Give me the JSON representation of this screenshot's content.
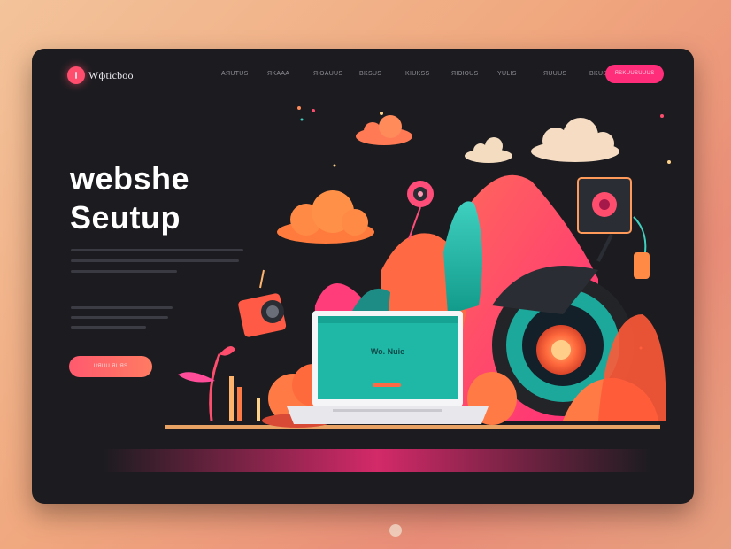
{
  "brand": {
    "name": "Wфticboo"
  },
  "nav": {
    "items": [
      "AЯUTUS",
      "ЯKAAA",
      "ЯЮAUUS",
      "BKSUS",
      "KIUKSS",
      "ЯЮЮUS",
      "YULIS",
      "ЯUUUS",
      "BKUS"
    ],
    "cta_label": "ЯSKUUSUUUS"
  },
  "hero": {
    "title_line1": "webshe",
    "title_line2": "Seutup",
    "button_label": "UЯUU ЯUЯS"
  },
  "laptop": {
    "screen_text": "Wo. Nuie"
  },
  "colors": {
    "background": "#1c1c20",
    "accent_pink": "#ff2d7a",
    "accent_orange": "#ff7b62",
    "teal": "#1fb8a6"
  }
}
